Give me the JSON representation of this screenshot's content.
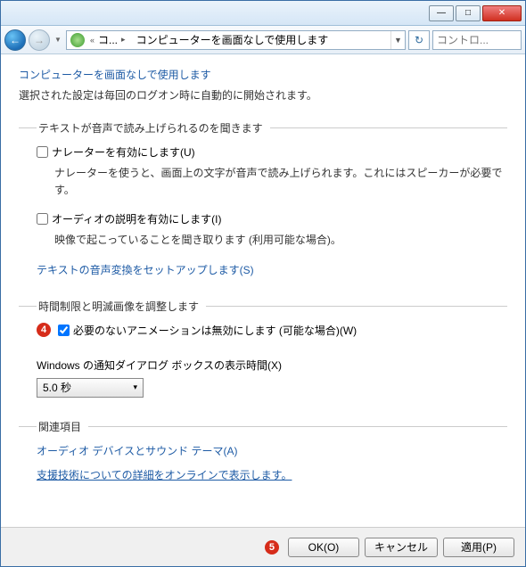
{
  "titlebar": {
    "min_icon": "—",
    "max_icon": "□",
    "close_icon": "✕"
  },
  "navbar": {
    "back_icon": "←",
    "fwd_icon": "→",
    "drop_icon": "▼",
    "crumb1": "コ...",
    "crumb_sep1": "«",
    "crumb_sep2": "▸",
    "crumb2": "コンピューターを画面なしで使用します",
    "addr_drop": "▼",
    "refresh_icon": "↻",
    "search_placeholder": "コントロ..."
  },
  "page": {
    "title": "コンピューターを画面なしで使用します",
    "subtitle": "選択された設定は毎回のログオン時に自動的に開始されます。"
  },
  "section1": {
    "legend": "テキストが音声で読み上げられるのを聞きます",
    "cb1_label": "ナレーターを有効にします(U)",
    "cb1_checked": false,
    "desc1": "ナレーターを使うと、画面上の文字が音声で読み上げられます。これにはスピーカーが必要です。",
    "cb2_label": "オーディオの説明を有効にします(I)",
    "cb2_checked": false,
    "desc2": "映像で起こっていることを聞き取ります (利用可能な場合)。",
    "link": "テキストの音声変換をセットアップします(S)"
  },
  "section2": {
    "legend": "時間制限と明滅画像を調整します",
    "badge": "4",
    "cb_label": "必要のないアニメーションは無効にします (可能な場合)(W)",
    "cb_checked": true,
    "sub_label": "Windows の通知ダイアログ ボックスの表示時間(X)",
    "select_value": "5.0 秒",
    "select_arrow": "▾"
  },
  "section3": {
    "legend": "関連項目",
    "link1": "オーディオ デバイスとサウンド テーマ(A)",
    "link2": "支援技術についての詳細をオンラインで表示します。"
  },
  "footer": {
    "badge": "5",
    "ok": "OK(O)",
    "cancel": "キャンセル",
    "apply": "適用(P)"
  }
}
